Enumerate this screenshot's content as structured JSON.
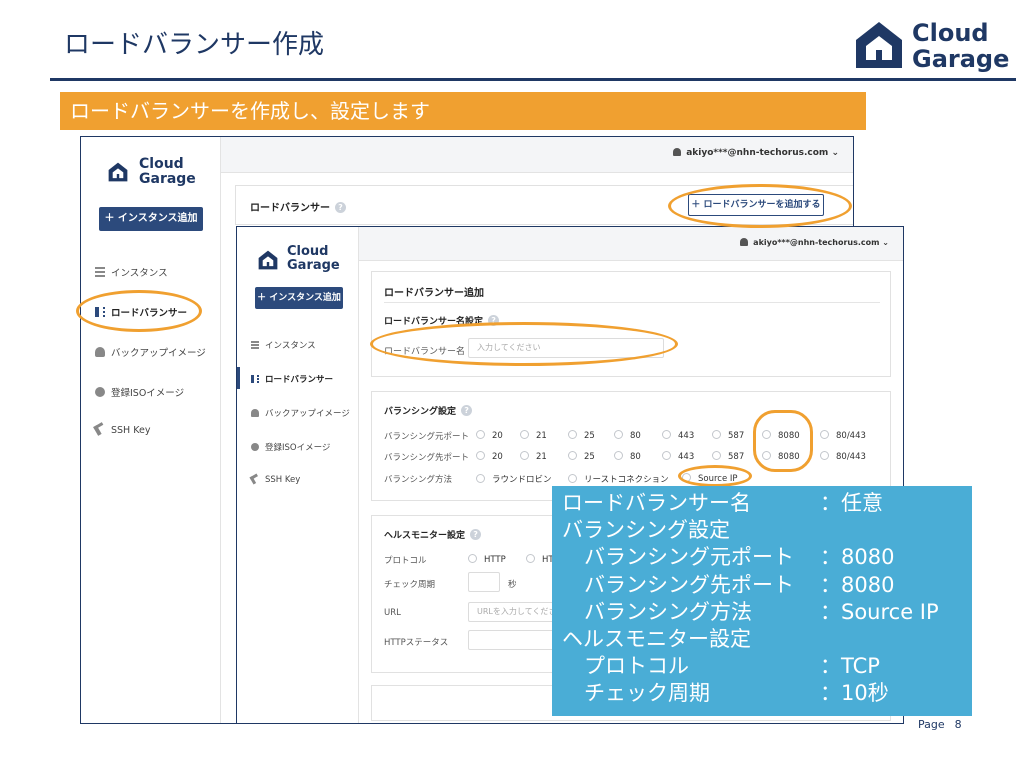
{
  "slide": {
    "title": "ロードバランサー作成",
    "banner": "ロードバランサーを作成し、設定します",
    "brand_line1": "Cloud",
    "brand_line2": "Garage",
    "page_label": "Page",
    "page_number": "8"
  },
  "console": {
    "logo_line1": "Cloud",
    "logo_line2": "Garage",
    "add_instance_button": "＋ インスタンス追加",
    "user": "akiyo***@nhn-techorus.com",
    "nav": [
      {
        "label": "インスタンス",
        "icon": "list-icon"
      },
      {
        "label": "ロードバランサー",
        "icon": "load-balancer-icon"
      },
      {
        "label": "バックアップイメージ",
        "icon": "cloud-icon"
      },
      {
        "label": "登録ISOイメージ",
        "icon": "disc-icon"
      },
      {
        "label": "SSH Key",
        "icon": "key-icon"
      }
    ]
  },
  "lb_list": {
    "title": "ロードバランサー",
    "add_button": "＋ ロードバランサーを追加する"
  },
  "lb_form": {
    "title": "ロードバランサー追加",
    "name_section": "ロードバランサー名設定",
    "name_label": "ロードバランサー名",
    "name_placeholder": "入力してください",
    "balancing_section": "バランシング設定",
    "source_port_label": "バランシング元ポート",
    "dest_port_label": "バランシング先ポート",
    "method_label": "バランシング方法",
    "ports": [
      "20",
      "21",
      "25",
      "80",
      "443",
      "587",
      "8080",
      "80/443"
    ],
    "methods": [
      "ラウンドロビン",
      "リーストコネクション",
      "Source IP"
    ],
    "health_section": "ヘルスモニター設定",
    "protocol_label": "プロトコル",
    "protocols": [
      "HTTP",
      "HT"
    ],
    "check_interval_label": "チェック周期",
    "seconds_unit": "秒",
    "url_label": "URL",
    "url_placeholder": "URLを入力してくださ",
    "http_status_label": "HTTPステータス"
  },
  "summary": [
    {
      "key": "ロードバランサー名",
      "value": "：任意",
      "indent": false
    },
    {
      "key": "バランシング設定",
      "value": "",
      "indent": false
    },
    {
      "key": "バランシング元ポート",
      "value": "：8080",
      "indent": true
    },
    {
      "key": "バランシング先ポート",
      "value": "：8080",
      "indent": true
    },
    {
      "key": "バランシング方法",
      "value": "：Source IP",
      "indent": true
    },
    {
      "key": "ヘルスモニター設定",
      "value": "",
      "indent": false
    },
    {
      "key": "プロトコル",
      "value": "：TCP",
      "indent": true
    },
    {
      "key": "チェック周期",
      "value": "：10秒",
      "indent": true
    }
  ],
  "colors": {
    "navy": "#1f3864",
    "accent_orange": "#f0a030",
    "info_blue": "#4aadd6",
    "button_navy": "#2c4a7c"
  }
}
